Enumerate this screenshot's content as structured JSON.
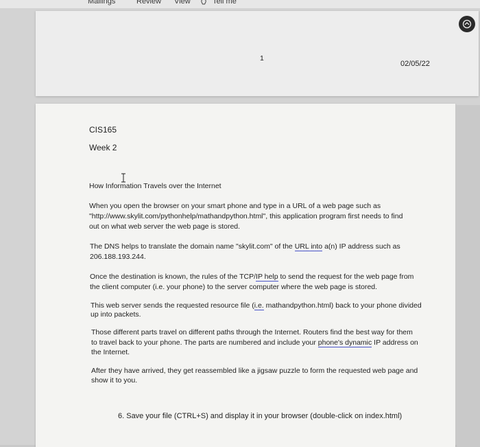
{
  "ribbon": {
    "tabs": [
      "Mailings",
      "Review",
      "View"
    ],
    "tell_me": "Tell me"
  },
  "page1": {
    "page_number": "1",
    "date": "02/05/22"
  },
  "document": {
    "course": "CIS165",
    "week": "Week 2",
    "heading": "How Information Travels over the Internet",
    "p1": [
      "When you open the browser on your smart phone and type in a URL of a web page such as",
      "\"http://www.skylit.com/pythonhelp/mathandpython.html\", this application program first needs to find",
      "out on what web server the web page is stored."
    ],
    "p2": {
      "l1_a": "The DNS helps to translate the domain name \"skylit.com\" of the ",
      "l1_u": "URL  into",
      "l1_b": " a(n) IP address such as",
      "l2": "206.188.193.244."
    },
    "p3": {
      "l1_a": "Once the destination is known, the rules of the TCP/",
      "l1_u": "IP  help",
      "l1_b": " to send the request for the web page from",
      "l2": "the client computer (i.e. your phone) to the server  computer where the web page is stored."
    },
    "p4": {
      "l1_a": "This web server sends the requested resource file (",
      "l1_u": "i.e.",
      "l1_b": " mathandpython.html) back to your phone divided",
      "l2": "up into packets."
    },
    "p5": {
      "l1": "Those different parts travel on different paths through the Internet. Routers find the best way for them",
      "l2_a": "to travel back to your phone. The parts are numbered and include your ",
      "l2_u": "phone's  dynamic",
      "l2_b": " IP address on",
      "l3": "the Internet."
    },
    "p6": [
      "After they have arrived, they get reassembled like a jigsaw puzzle to form the requested web page and",
      "show it to you."
    ],
    "step": "6.   Save your file (CTRL+S) and display it in your browser (double-click on index.html)"
  }
}
